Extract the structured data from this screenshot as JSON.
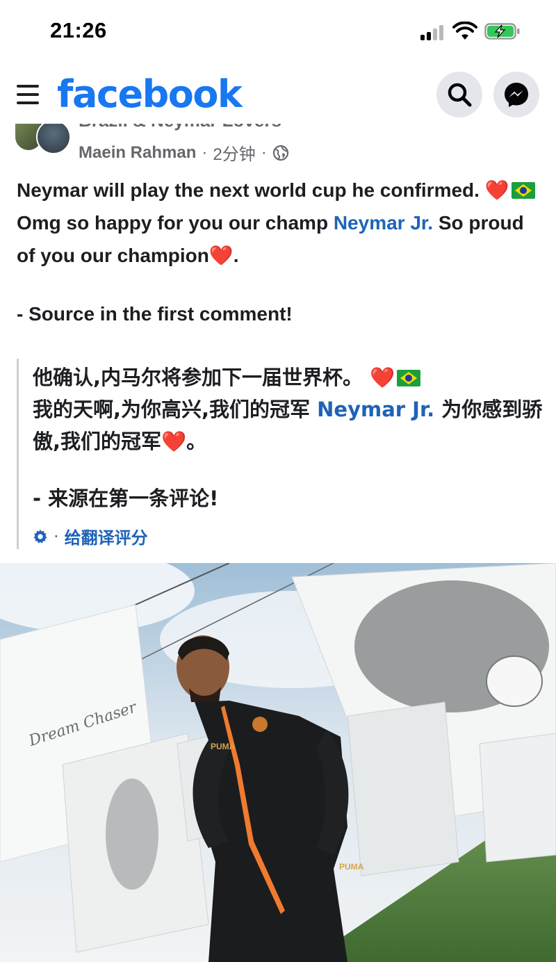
{
  "status_bar": {
    "time": "21:26"
  },
  "header": {
    "logo": "facebook",
    "icons": [
      "menu-icon",
      "search-icon",
      "messenger-icon"
    ]
  },
  "post": {
    "group_name": "Brazil & Neymar Lovers",
    "author": "Maein Rahman",
    "time": "2分钟",
    "audience_icon": "globe-icon",
    "text": {
      "line1": "Neymar will play the next world cup he confirmed. ",
      "line2a": "Omg so happy for you our champ ",
      "mention": "Neymar Jr.",
      "line2b": " So proud of you our champion",
      "line2c": ".",
      "line3": "- Source in the first comment!"
    },
    "translation": {
      "line1": "他确认,内马尔将参加下一届世界杯。 ",
      "line2a": "我的天啊,为你高兴,我们的冠军 ",
      "mention": "Neymar Jr.",
      "line2b": " 为你感到骄傲,我们的冠军",
      "line2c": "。",
      "line3": "- 来源在第一条评论!",
      "rate_label": "给翻译评分",
      "settings_icon": "gear-icon"
    }
  },
  "photo": {
    "subject": "player-in-black-tracksuit",
    "jacket_brand": "PUMA"
  }
}
